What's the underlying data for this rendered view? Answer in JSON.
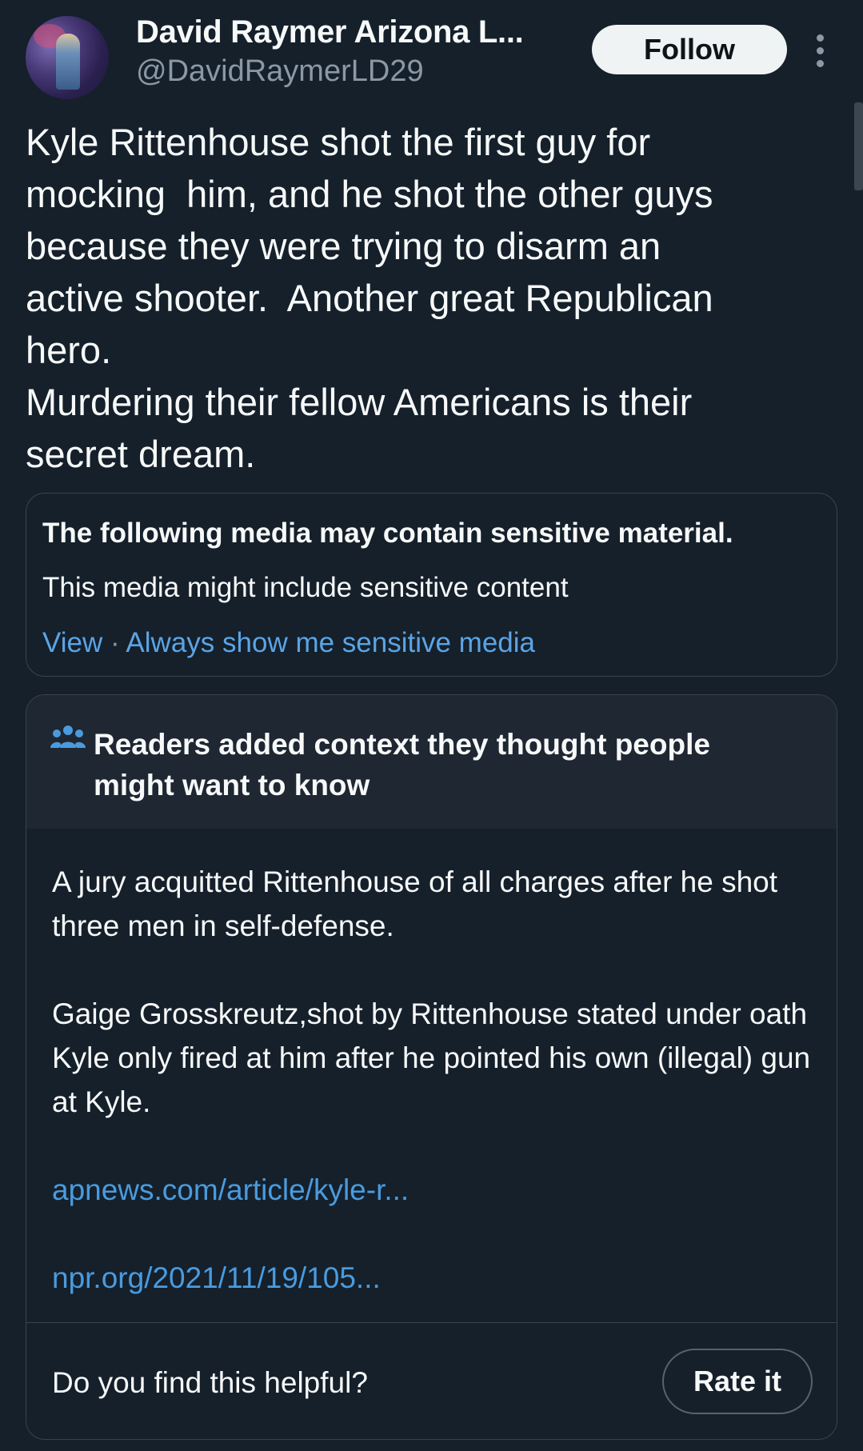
{
  "author": {
    "display_name": "David Raymer Arizona L...",
    "handle": "@DavidRaymerLD29",
    "follow_label": "Follow"
  },
  "tweet": {
    "text": "Kyle Rittenhouse shot the first guy for\nmocking  him, and he shot the other guys\nbecause they were trying to disarm an\nactive shooter.  Another great Republican\nhero.\nMurdering their fellow Americans is their\nsecret dream."
  },
  "sensitive_media": {
    "title": "The following media may contain sensitive material.",
    "description": "This media might include sensitive content",
    "view_label": "View",
    "separator": " · ",
    "always_show_label": "Always show me sensitive media"
  },
  "community_note": {
    "header": "Readers added context they thought people might want to know",
    "paragraph_1": "A jury acquitted Rittenhouse of all charges after he shot three men in self-defense.",
    "paragraph_2": "Gaige Grosskreutz,shot by Rittenhouse stated under oath Kyle only fired at him after he pointed his own (illegal) gun at Kyle.",
    "link_1": "apnews.com/article/kyle-r...",
    "link_2": "npr.org/2021/11/19/105...",
    "helpful_prompt": "Do you find this helpful?",
    "rate_label": "Rate it"
  },
  "colors": {
    "background": "#15202b",
    "link": "#1d9bf0",
    "muted": "#8b98a5",
    "border": "#38444d"
  },
  "icons": {
    "more": "vertical-ellipsis-icon",
    "note": "people-icon"
  }
}
